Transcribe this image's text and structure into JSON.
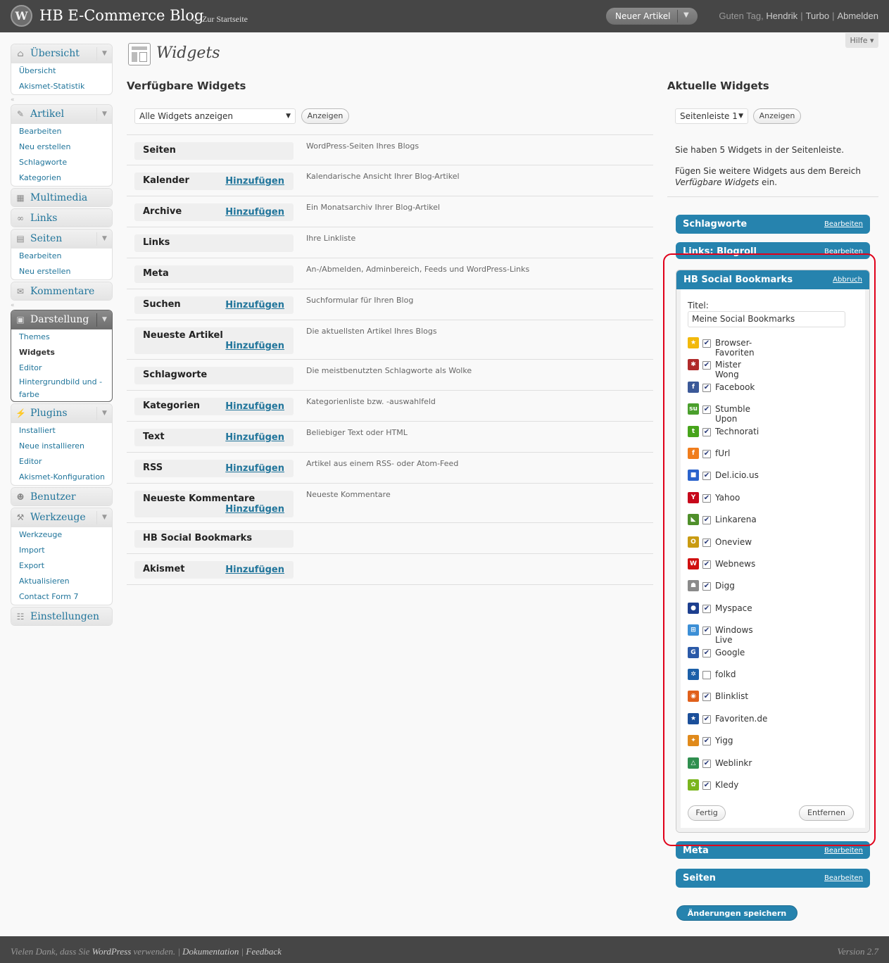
{
  "header": {
    "site_title": "HB E-Commerce Blog",
    "visit_site": "← Zur Startseite",
    "favorite_action": "Neuer Artikel",
    "greeting": "Guten Tag,",
    "user": "Hendrik",
    "turbo": "Turbo",
    "logout": "Abmelden",
    "help": "Hilfe"
  },
  "menu": {
    "overview": {
      "label": "Übersicht",
      "items": [
        "Übersicht",
        "Akismet-Statistik"
      ]
    },
    "posts": {
      "label": "Artikel",
      "items": [
        "Bearbeiten",
        "Neu erstellen",
        "Schlagworte",
        "Kategorien"
      ]
    },
    "media": "Multimedia",
    "links": "Links",
    "pages": {
      "label": "Seiten",
      "items": [
        "Bearbeiten",
        "Neu erstellen"
      ]
    },
    "comments": "Kommentare",
    "appearance": {
      "label": "Darstellung",
      "items": [
        "Themes",
        "Widgets",
        "Editor",
        "Hintergrundbild und -farbe"
      ]
    },
    "plugins": {
      "label": "Plugins",
      "items": [
        "Installiert",
        "Neue installieren",
        "Editor",
        "Akismet-Konfiguration"
      ]
    },
    "users": "Benutzer",
    "tools": {
      "label": "Werkzeuge",
      "items": [
        "Werkzeuge",
        "Import",
        "Export",
        "Aktualisieren",
        "Contact Form 7"
      ]
    },
    "settings": "Einstellungen"
  },
  "page": {
    "title": "Widgets",
    "available_heading": "Verfügbare Widgets",
    "current_heading": "Aktuelle Widgets",
    "filter_select": "Alle Widgets anzeigen",
    "show_button": "Anzeigen",
    "sidebar_select": "Seitenleiste 1",
    "sidebar_show_button": "Anzeigen",
    "info1": "Sie haben 5 Widgets in der Seitenleiste.",
    "info2_pre": "Fügen Sie weitere Widgets aus dem Bereich ",
    "info2_em": "Verfügbare Widgets",
    "info2_post": " ein.",
    "save_button": "Änderungen speichern"
  },
  "available_widgets": [
    {
      "name": "Seiten",
      "add": "",
      "desc": "WordPress-Seiten Ihres Blogs"
    },
    {
      "name": "Kalender",
      "add": "Hinzufügen",
      "desc": "Kalendarische Ansicht Ihrer Blog-Artikel"
    },
    {
      "name": "Archive",
      "add": "Hinzufügen",
      "desc": "Ein Monatsarchiv Ihrer Blog-Artikel"
    },
    {
      "name": "Links",
      "add": "",
      "desc": "Ihre Linkliste"
    },
    {
      "name": "Meta",
      "add": "",
      "desc": "An-/Abmelden, Adminbereich, Feeds und WordPress-Links"
    },
    {
      "name": "Suchen",
      "add": "Hinzufügen",
      "desc": "Suchformular für Ihren Blog"
    },
    {
      "name": "Neueste Artikel",
      "add": "Hinzufügen",
      "desc": "Die aktuellsten Artikel Ihres Blogs"
    },
    {
      "name": "Schlagworte",
      "add": "",
      "desc": "Die meistbenutzten Schlagworte als Wolke"
    },
    {
      "name": "Kategorien",
      "add": "Hinzufügen",
      "desc": "Kategorienliste bzw. -auswahlfeld"
    },
    {
      "name": "Text",
      "add": "Hinzufügen",
      "desc": "Beliebiger Text oder HTML"
    },
    {
      "name": "RSS",
      "add": "Hinzufügen",
      "desc": "Artikel aus einem RSS- oder Atom-Feed"
    },
    {
      "name": "Neueste Kommentare",
      "add": "Hinzufügen",
      "desc": "Neueste Kommentare"
    },
    {
      "name": "HB Social Bookmarks",
      "add": "",
      "desc": ""
    },
    {
      "name": "Akismet",
      "add": "Hinzufügen",
      "desc": ""
    }
  ],
  "sidebar_widgets": {
    "w1": {
      "title": "Schlagworte",
      "action": "Bearbeiten"
    },
    "w2": {
      "title": "Links: Blogroll",
      "action": "Bearbeiten"
    },
    "open": {
      "title": "HB Social Bookmarks",
      "action": "Abbruch",
      "field_label": "Titel:",
      "field_value": "Meine Social Bookmarks",
      "done_button": "Fertig",
      "remove_button": "Entfernen"
    },
    "w4": {
      "title": "Meta",
      "action": "Bearbeiten"
    },
    "w5": {
      "title": "Seiten",
      "action": "Bearbeiten"
    }
  },
  "bookmarks": [
    {
      "name": "Browser-Favoriten",
      "checked": true,
      "icon": "star-icon",
      "color": "#f2b90c",
      "glyph": "★"
    },
    {
      "name": "Mister Wong",
      "checked": true,
      "icon": "misterwong-icon",
      "color": "#b02a2a",
      "glyph": "✱"
    },
    {
      "name": "Facebook",
      "checked": true,
      "icon": "facebook-icon",
      "color": "#3b5998",
      "glyph": "f"
    },
    {
      "name": "Stumble Upon",
      "checked": true,
      "icon": "stumbleupon-icon",
      "color": "#4a9f2c",
      "glyph": "su"
    },
    {
      "name": "Technorati",
      "checked": true,
      "icon": "technorati-icon",
      "color": "#47a41b",
      "glyph": "t"
    },
    {
      "name": "fUrl",
      "checked": true,
      "icon": "furl-icon",
      "color": "#f07d1c",
      "glyph": "f"
    },
    {
      "name": "Del.icio.us",
      "checked": true,
      "icon": "delicious-icon",
      "color": "#2a63cc",
      "glyph": "■"
    },
    {
      "name": "Yahoo",
      "checked": true,
      "icon": "yahoo-icon",
      "color": "#c7081b",
      "glyph": "Y"
    },
    {
      "name": "Linkarena",
      "checked": true,
      "icon": "linkarena-icon",
      "color": "#4f8f2a",
      "glyph": "◣"
    },
    {
      "name": "Oneview",
      "checked": true,
      "icon": "oneview-icon",
      "color": "#c99b12",
      "glyph": "O"
    },
    {
      "name": "Webnews",
      "checked": true,
      "icon": "webnews-icon",
      "color": "#d01010",
      "glyph": "W"
    },
    {
      "name": "Digg",
      "checked": true,
      "icon": "digg-icon",
      "color": "#8a8a8a",
      "glyph": "☗"
    },
    {
      "name": "Myspace",
      "checked": true,
      "icon": "myspace-icon",
      "color": "#1d3f8f",
      "glyph": "●"
    },
    {
      "name": "Windows Live",
      "checked": true,
      "icon": "windowslive-icon",
      "color": "#3c8fd6",
      "glyph": "⊞"
    },
    {
      "name": "Google",
      "checked": true,
      "icon": "google-icon",
      "color": "#2b5aa8",
      "glyph": "G"
    },
    {
      "name": "folkd",
      "checked": false,
      "icon": "folkd-icon",
      "color": "#1b5fa8",
      "glyph": "✲"
    },
    {
      "name": "Blinklist",
      "checked": true,
      "icon": "blinklist-icon",
      "color": "#e0601b",
      "glyph": "◉"
    },
    {
      "name": "Favoriten.de",
      "checked": true,
      "icon": "favoriten-icon",
      "color": "#1b4f9a",
      "glyph": "★"
    },
    {
      "name": "Yigg",
      "checked": true,
      "icon": "yigg-icon",
      "color": "#e08a1b",
      "glyph": "✦"
    },
    {
      "name": "Weblinkr",
      "checked": true,
      "icon": "weblinkr-icon",
      "color": "#2f8f4f",
      "glyph": "△"
    },
    {
      "name": "Kledy",
      "checked": true,
      "icon": "kledy-icon",
      "color": "#7ab51d",
      "glyph": "✿"
    }
  ],
  "footer": {
    "thanks_pre": "Vielen Dank, dass Sie ",
    "wordpress": "WordPress",
    "thanks_post": " verwenden.",
    "docs": "Dokumentation",
    "feedback": "Feedback",
    "version": "Version 2.7"
  }
}
